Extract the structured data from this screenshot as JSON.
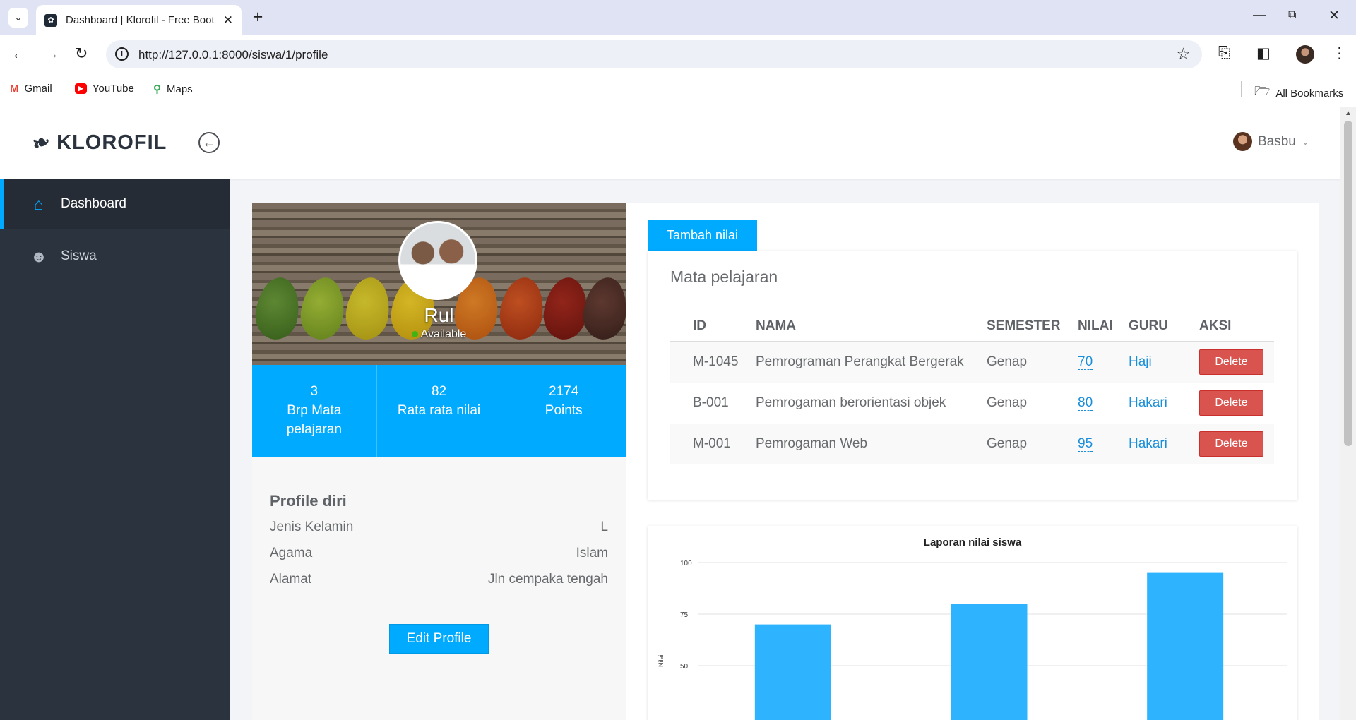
{
  "browser": {
    "tab_title": "Dashboard | Klorofil - Free Boot",
    "url": "http://127.0.0.1:8000/siswa/1/profile",
    "bookmarks": [
      "Gmail",
      "YouTube",
      "Maps"
    ],
    "all_bookmarks": "All Bookmarks"
  },
  "app": {
    "brand": "KLOROFIL",
    "user_name": "Basbu"
  },
  "sidebar": {
    "items": [
      {
        "label": "Dashboard",
        "icon": "home-icon",
        "active": true
      },
      {
        "label": "Siswa",
        "icon": "user-icon",
        "active": false
      }
    ]
  },
  "profile": {
    "name": "Rul",
    "status": "Available",
    "stats": [
      {
        "value": "3",
        "label": "Brp Mata pelajaran"
      },
      {
        "value": "82",
        "label": "Rata rata nilai"
      },
      {
        "value": "2174",
        "label": "Points"
      }
    ],
    "section_title": "Profile diri",
    "fields": [
      {
        "label": "Jenis Kelamin",
        "value": "L"
      },
      {
        "label": "Agama",
        "value": "Islam"
      },
      {
        "label": "Alamat",
        "value": "Jln cempaka tengah"
      }
    ],
    "edit_label": "Edit Profile"
  },
  "subjects": {
    "add_label": "Tambah nilai",
    "title": "Mata pelajaran",
    "headers": [
      "ID",
      "NAMA",
      "SEMESTER",
      "NILAI",
      "GURU",
      "AKSI"
    ],
    "rows": [
      {
        "id": "M-1045",
        "nama": "Pemrograman Perangkat Bergerak",
        "semester": "Genap",
        "nilai": "70",
        "guru": "Haji",
        "aksi": "Delete"
      },
      {
        "id": "B-001",
        "nama": "Pemrogaman berorientasi objek",
        "semester": "Genap",
        "nilai": "80",
        "guru": "Hakari",
        "aksi": "Delete"
      },
      {
        "id": "M-001",
        "nama": "Pemrogaman Web",
        "semester": "Genap",
        "nilai": "95",
        "guru": "Hakari",
        "aksi": "Delete"
      }
    ]
  },
  "chart_data": {
    "type": "bar",
    "title": "Laporan nilai siswa",
    "ylabel": "Nilai",
    "categories": [
      "",
      "",
      ""
    ],
    "values": [
      70,
      80,
      95
    ],
    "ylim": [
      0,
      100
    ],
    "yticks": [
      50,
      75,
      100
    ],
    "grid": true,
    "color": "#2eb4ff"
  },
  "colors": {
    "accent": "#00aaff",
    "sidebar": "#2b333e",
    "danger": "#d9534f"
  }
}
